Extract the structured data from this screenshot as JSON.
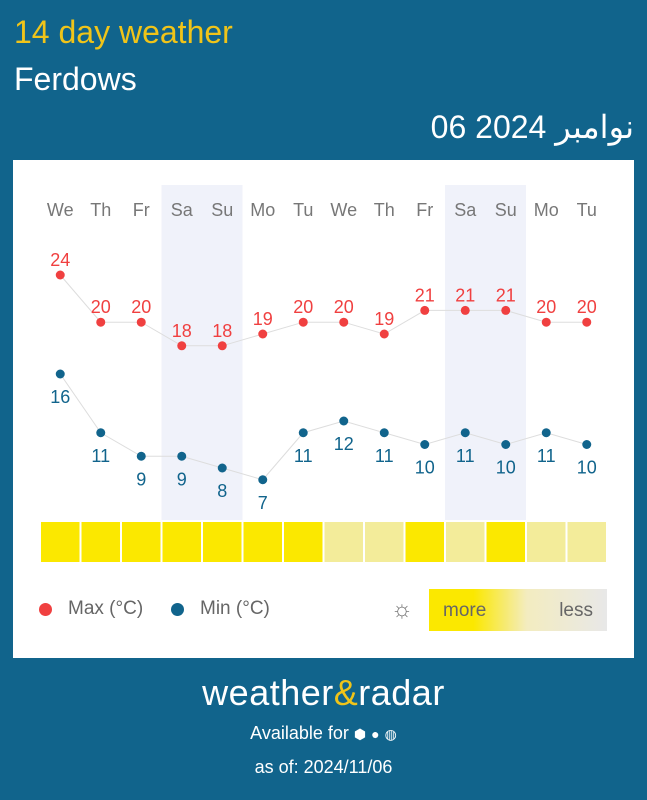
{
  "header": {
    "title": "14 day weather",
    "location": "Ferdows",
    "date": "06 نوامبر 2024"
  },
  "chart_data": {
    "type": "line",
    "days": [
      "We",
      "Th",
      "Fr",
      "Sa",
      "Su",
      "Mo",
      "Tu",
      "We",
      "Th",
      "Fr",
      "Sa",
      "Su",
      "Mo",
      "Tu"
    ],
    "weekend_indices": [
      3,
      4,
      10,
      11
    ],
    "series": [
      {
        "name": "Max (°C)",
        "color": "#f04040",
        "values": [
          24,
          20,
          20,
          18,
          18,
          19,
          20,
          20,
          19,
          21,
          21,
          21,
          20,
          20
        ]
      },
      {
        "name": "Min (°C)",
        "color": "#11648c",
        "values": [
          16,
          11,
          9,
          9,
          8,
          7,
          11,
          12,
          11,
          10,
          11,
          10,
          11,
          10
        ]
      }
    ],
    "sunshine": {
      "levels": [
        1,
        1,
        1,
        1,
        1,
        1,
        1,
        0,
        0,
        1,
        0,
        1,
        0,
        0
      ],
      "colors": {
        "more": "#fbe800",
        "less": "#f3ec9a"
      }
    }
  },
  "legend": {
    "max": "Max (°C)",
    "min": "Min (°C)",
    "sun_icon": "sun-icon",
    "more": "more",
    "less": "less"
  },
  "footer": {
    "brand_left": "weather",
    "brand_amp": "&",
    "brand_right": "radar",
    "available": "Available for",
    "icons": [
      "android-icon",
      "apple-icon",
      "globe-icon"
    ],
    "as_of": "as of: 2024/11/06"
  }
}
